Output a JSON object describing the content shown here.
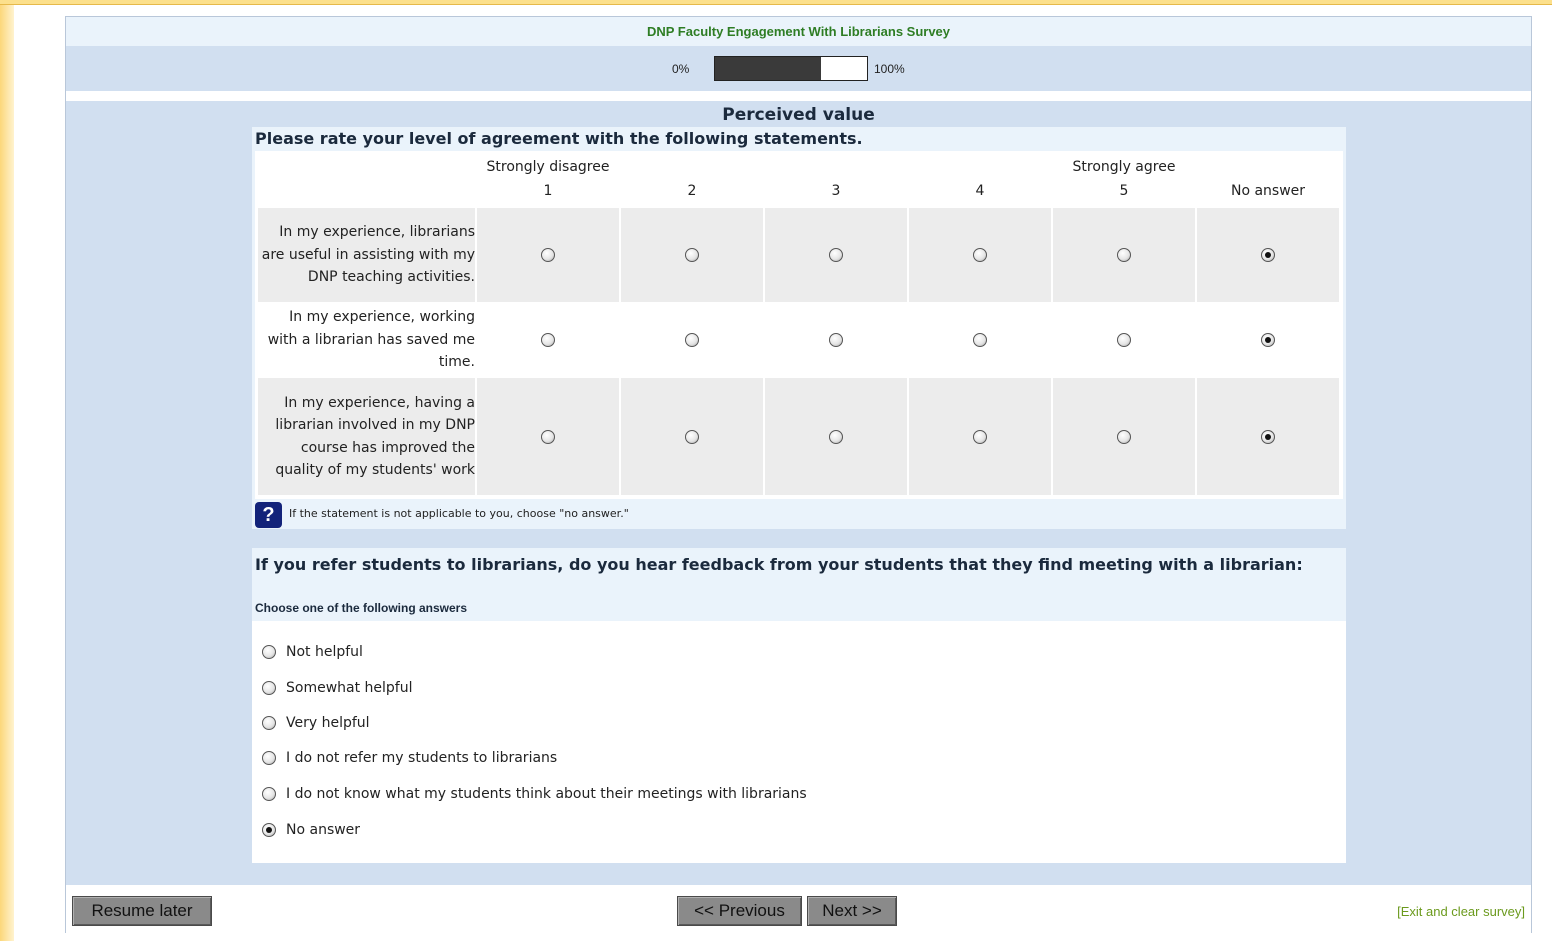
{
  "survey": {
    "title": "DNP Faculty Engagement With Librarians Survey",
    "progress": {
      "min_label": "0%",
      "max_label": "100%",
      "fraction": 0.7
    }
  },
  "group": {
    "title": "Perceived value"
  },
  "question1": {
    "text": "Please rate your level of agreement with the following statements.",
    "scale_top_labels": [
      "Strongly disagree",
      "",
      "",
      "",
      "Strongly agree",
      ""
    ],
    "scale_labels": [
      "1",
      "2",
      "3",
      "4",
      "5",
      "No answer"
    ],
    "rows": [
      {
        "label": "In my experience, librarians are useful in assisting with my DNP teaching activities.",
        "selected": 5
      },
      {
        "label": "In my experience, working with a librarian has saved me time.",
        "selected": 5
      },
      {
        "label": "In my experience, having a librarian involved in my DNP course has improved the quality of my students' work",
        "selected": 5
      }
    ],
    "help_text": "If the statement is not applicable to you, choose \"no answer.\""
  },
  "question2": {
    "text": "If you refer students to librarians, do you hear feedback from your students that they find meeting with a librarian:",
    "help": "Choose one of the following answers",
    "options": [
      {
        "label": "Not helpful",
        "checked": false
      },
      {
        "label": "Somewhat helpful",
        "checked": false
      },
      {
        "label": "Very helpful",
        "checked": false
      },
      {
        "label": "I do not refer my students to librarians",
        "checked": false
      },
      {
        "label": "I do not know what my students think about their meetings with librarians",
        "checked": false
      },
      {
        "label": "No answer",
        "checked": true
      }
    ]
  },
  "nav": {
    "resume_label": "Resume later",
    "previous_label": "<< Previous",
    "next_label": "Next >>",
    "exit_label": "[Exit and clear survey]"
  },
  "icons": {
    "help": "question-mark-icon"
  },
  "colors": {
    "title_green": "#2e7d24",
    "panel_blue": "#d1dff0",
    "help_navy": "#13237a",
    "exit_green": "#6b9a1d"
  }
}
